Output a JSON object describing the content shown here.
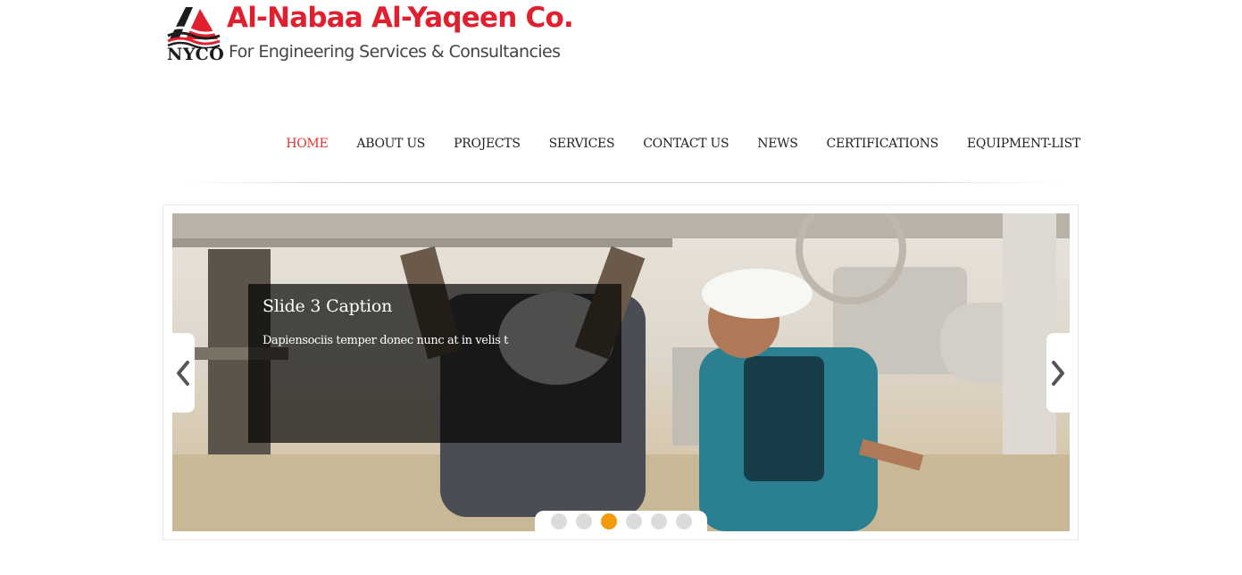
{
  "logo": {
    "abbr": "NYCO",
    "title": "Al-Nabaa Al-Yaqeen Co.",
    "subtitle": "For Engineering Services & Consultancies"
  },
  "nav": {
    "items": [
      "HOME",
      "ABOUT US",
      "PROJECTS",
      "SERVICES",
      "CONTACT US",
      "NEWS",
      "CERTIFICATIONS",
      "EQUIPMENT-LIST"
    ],
    "active_index": 0
  },
  "slider": {
    "caption_title": "Slide 3 Caption",
    "caption_text": "Dapiensociis temper donec nunc at in velis t",
    "pager_count": 6,
    "active_slide": 3,
    "prev_icon": "chevron-left-icon",
    "next_icon": "chevron-right-icon"
  },
  "colors": {
    "brand_red": "#e0202e",
    "nav_active": "#e53030",
    "pager_active": "#f09a0c"
  }
}
